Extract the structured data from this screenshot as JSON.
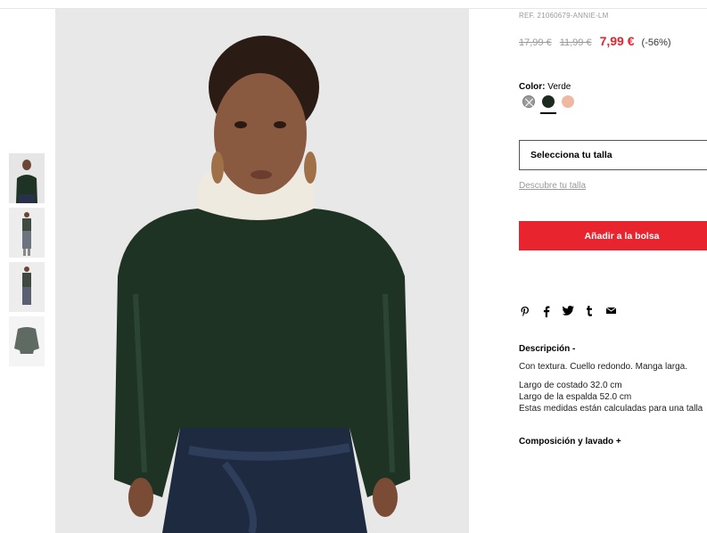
{
  "product": {
    "ref": "REF. 21060679-ANNIE-LM",
    "price_original": "17,99 €",
    "price_previous": "11,99 €",
    "price_current": "7,99 €",
    "discount": "(-56%)"
  },
  "color": {
    "label": "Color:",
    "selected": "Verde",
    "swatches": [
      {
        "name": "Gris",
        "hex": "#9a9a9a"
      },
      {
        "name": "Verde",
        "hex": "#1c2a20"
      },
      {
        "name": "Rosa",
        "hex": "#efb8a1"
      }
    ]
  },
  "size": {
    "select_label": "Selecciona tu talla",
    "guide_link": "Descubre tu talla"
  },
  "actions": {
    "add_to_bag": "Añadir a la bolsa"
  },
  "share": {
    "icons": [
      "pinterest-icon",
      "facebook-icon",
      "twitter-icon",
      "tumblr-icon",
      "email-icon"
    ],
    "glyphs": [
      "℗",
      "f",
      "t",
      "t",
      "✉"
    ]
  },
  "description": {
    "title": "Descripción -",
    "lines": [
      "Con textura. Cuello redondo. Manga larga.",
      "Largo de costado 32.0 cm",
      "Largo de la espalda 52.0 cm",
      "Estas medidas están calculadas para una talla"
    ]
  },
  "composition": {
    "title": "Composición y lavado +"
  },
  "colors": {
    "accent_red": "#e8252f",
    "price_red": "#e6232e",
    "sweater_green": "#1f3325",
    "jeans_blue": "#1e2a40"
  }
}
